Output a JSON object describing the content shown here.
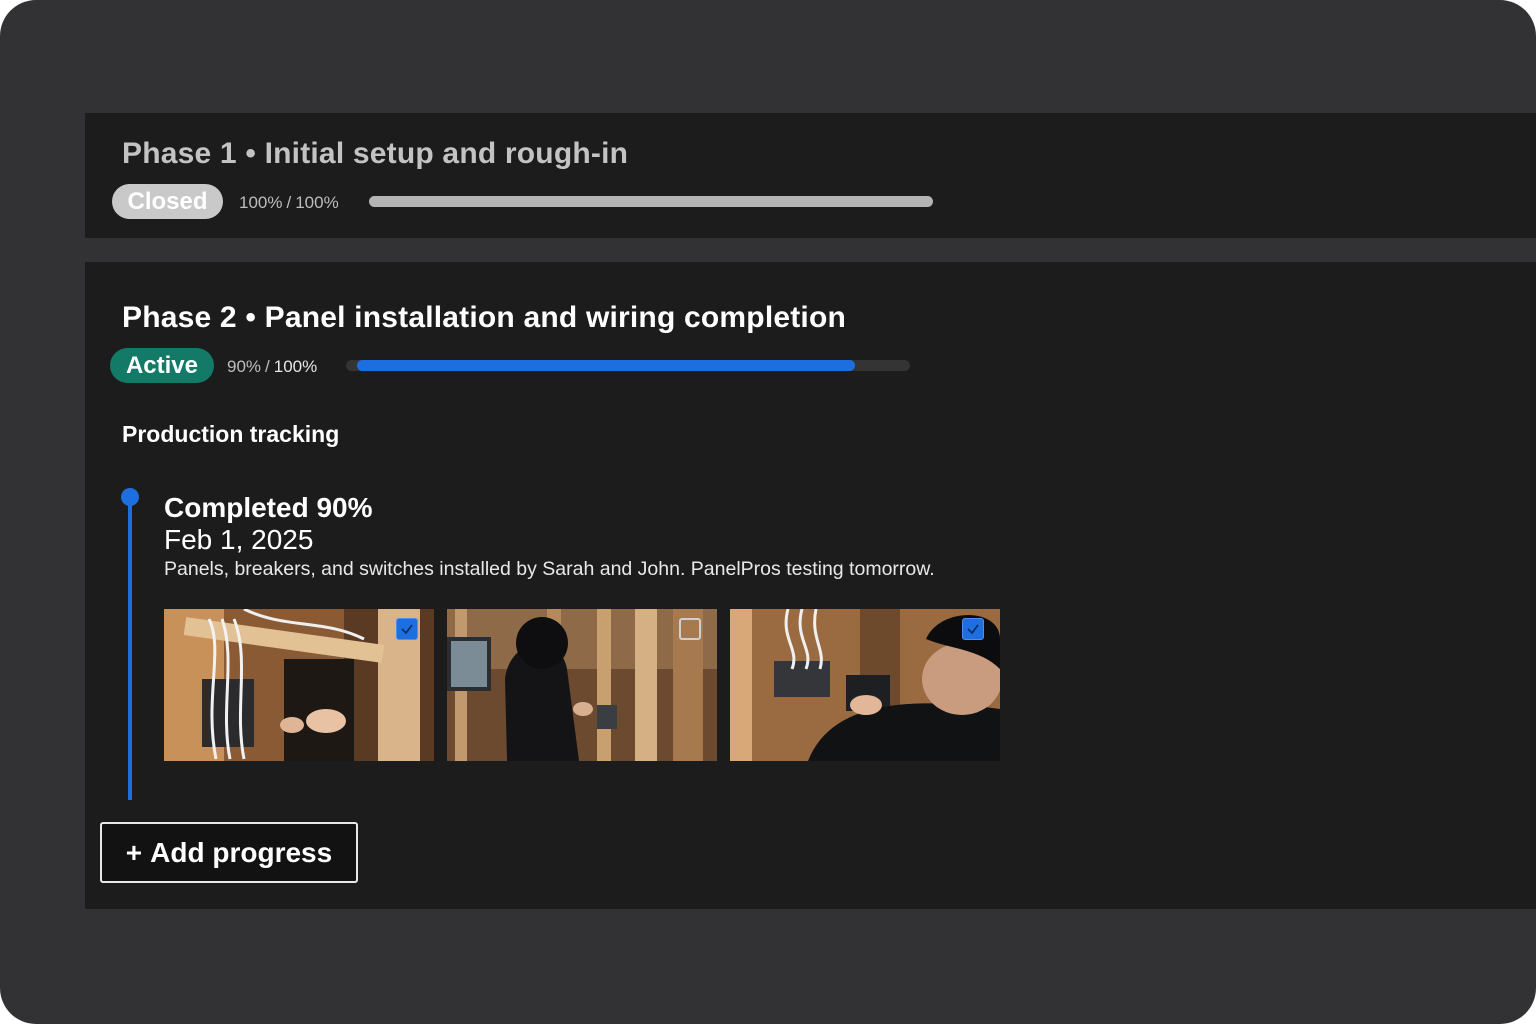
{
  "phases": [
    {
      "number_label": "Phase 1",
      "separator": "•",
      "title": "Initial setup and rough-in",
      "status": "Closed",
      "progress_current": "100%",
      "progress_sep": "/",
      "progress_total": "100%",
      "progress_fraction": 1.0,
      "status_color": "#c9c9c9",
      "bar_color": "#b4b4b4"
    },
    {
      "number_label": "Phase 2",
      "separator": "•",
      "title": "Panel installation and wiring completion",
      "status": "Active",
      "progress_current": "90%",
      "progress_sep": "/",
      "progress_total": "100%",
      "progress_fraction": 0.9,
      "status_color": "#137a68",
      "bar_color": "#1d6fe0",
      "section_title": "Production tracking",
      "entries": [
        {
          "title": "Completed 90%",
          "date": "Feb 1, 2025",
          "note": "Panels, breakers, and switches installed by Sarah and John. PanelPros testing tomorrow.",
          "photos": [
            {
              "subject": "electrician-wiring-junction-box",
              "selected": true
            },
            {
              "subject": "worker-in-hoodie-at-panel",
              "selected": false
            },
            {
              "subject": "worker-in-cap-installing-box",
              "selected": true
            }
          ]
        }
      ],
      "add_button": {
        "icon": "plus-icon",
        "label": "Add progress"
      }
    }
  ],
  "colors": {
    "accent": "#1d6fe0",
    "active_badge": "#137a68",
    "card_bg": "#1c1c1c",
    "frame_bg": "#323234"
  }
}
